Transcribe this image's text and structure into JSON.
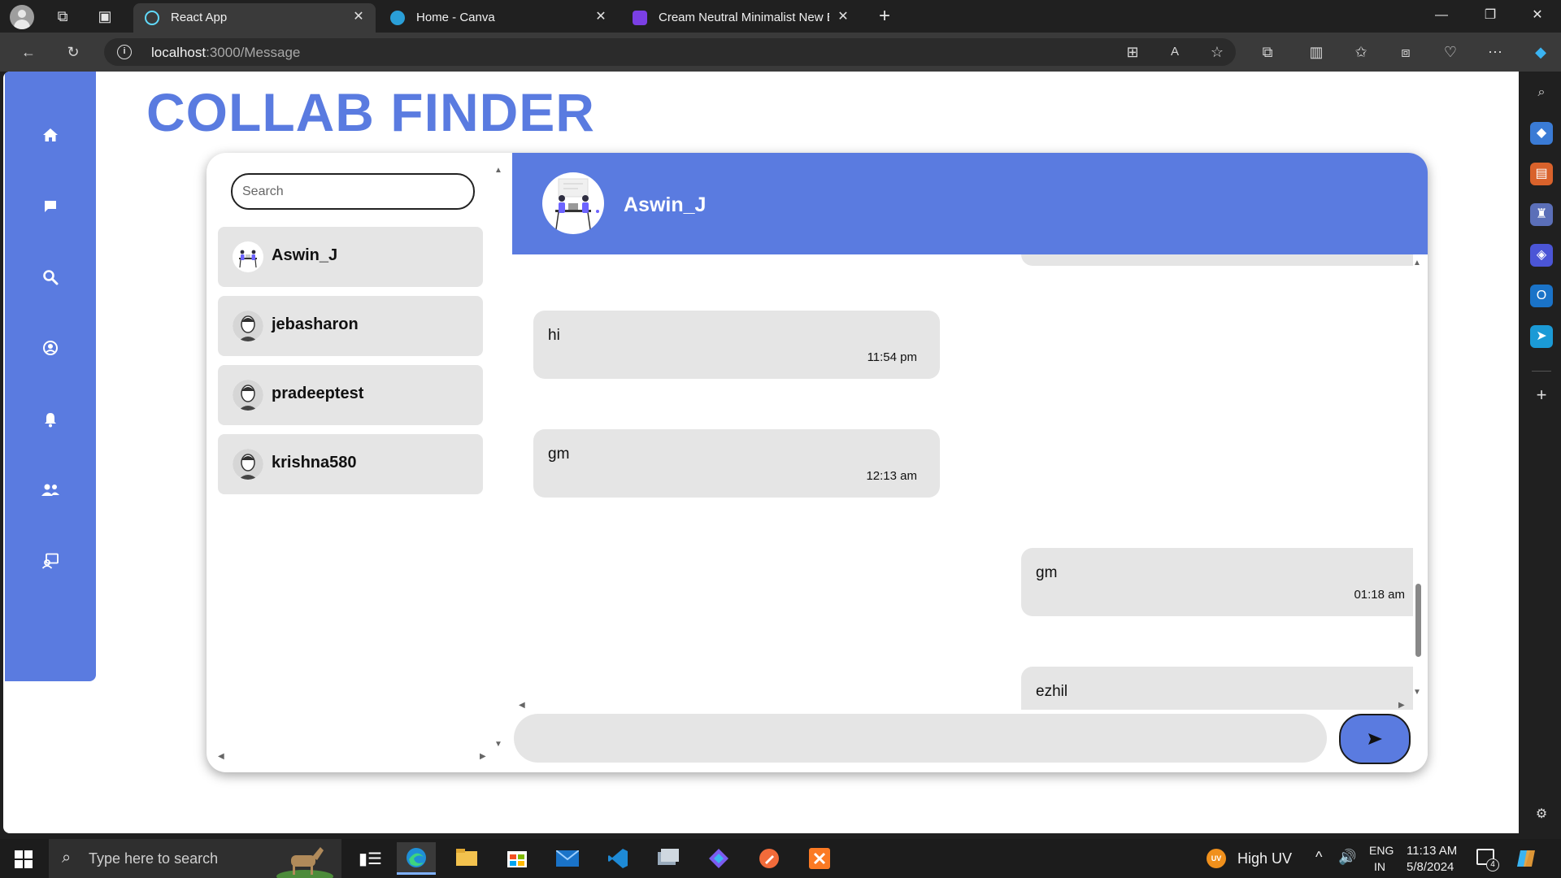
{
  "browser": {
    "tabs": [
      {
        "title": "React App",
        "active": true
      },
      {
        "title": "Home - Canva",
        "active": false
      },
      {
        "title": "Cream Neutral Minimalist New B",
        "active": false
      }
    ],
    "url_host": "localhost",
    "url_path": ":3000/Message"
  },
  "app": {
    "brand": "COLLAB FINDER",
    "accent_color": "#5a7be0",
    "nav_icons": [
      "home-icon",
      "chat-icon",
      "search-icon",
      "account-icon",
      "bell-icon",
      "group-icon",
      "contact-icon"
    ]
  },
  "search": {
    "placeholder": "Search"
  },
  "users": [
    {
      "name": "Aswin_J",
      "avatar": "illustration"
    },
    {
      "name": "jebasharon",
      "avatar": "default"
    },
    {
      "name": "pradeeptest",
      "avatar": "default"
    },
    {
      "name": "krishna580",
      "avatar": "default"
    }
  ],
  "chat": {
    "contact_name": "Aswin_J",
    "messages": [
      {
        "text": "",
        "time": "",
        "side": "right",
        "partial": "top"
      },
      {
        "text": "hi",
        "time": "11:54 pm",
        "side": "left"
      },
      {
        "text": "gm",
        "time": "12:13 am",
        "side": "left"
      },
      {
        "text": "gm",
        "time": "01:18 am",
        "side": "right"
      },
      {
        "text": "ezhil",
        "time": "",
        "side": "right",
        "partial": "bottom"
      }
    ]
  },
  "taskbar": {
    "search_placeholder": "Type here to search",
    "weather": "High UV",
    "weather_badge": "UV",
    "lang_line1": "ENG",
    "lang_line2": "IN",
    "time": "11:13 AM",
    "date": "5/8/2024",
    "notifications": "4"
  }
}
